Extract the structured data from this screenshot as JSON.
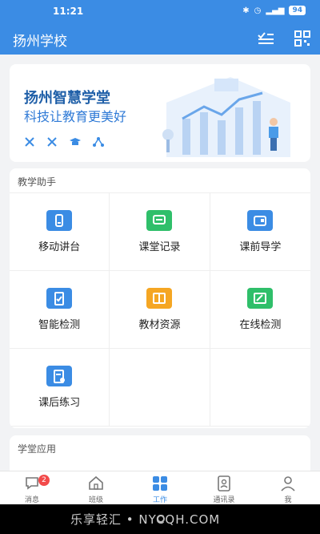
{
  "status": {
    "time": "11:21",
    "battery": "94"
  },
  "app": {
    "title": "扬州学校"
  },
  "banner": {
    "title": "扬州智慧学堂",
    "subtitle": "科技让教育更美好"
  },
  "sections": {
    "teaching": {
      "title": "教学助手",
      "items": [
        {
          "label": "移动讲台",
          "color": "#3b8ce4",
          "icon": "mobile-podium-icon"
        },
        {
          "label": "课堂记录",
          "color": "#2fbf6a",
          "icon": "class-record-icon"
        },
        {
          "label": "课前导学",
          "color": "#3b8ce4",
          "icon": "preview-guide-icon"
        },
        {
          "label": "智能检测",
          "color": "#3b8ce4",
          "icon": "smart-test-icon"
        },
        {
          "label": "教材资源",
          "color": "#f5a623",
          "icon": "textbook-icon"
        },
        {
          "label": "在线检测",
          "color": "#2fbf6a",
          "icon": "online-test-icon"
        },
        {
          "label": "课后练习",
          "color": "#3b8ce4",
          "icon": "homework-icon"
        }
      ]
    },
    "apps": {
      "title": "学堂应用"
    }
  },
  "tabs": [
    {
      "label": "消息",
      "badge": "2",
      "icon": "message-icon"
    },
    {
      "label": "班级",
      "icon": "class-home-icon"
    },
    {
      "label": "工作",
      "icon": "work-grid-icon"
    },
    {
      "label": "通讯录",
      "icon": "contacts-icon"
    },
    {
      "label": "我",
      "icon": "profile-icon"
    }
  ],
  "watermark": "乐享轻汇 • NYCQH.COM"
}
